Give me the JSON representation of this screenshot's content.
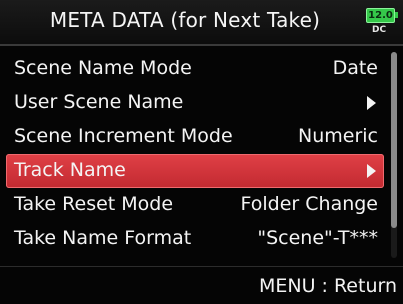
{
  "header": {
    "title": "META DATA (for Next Take)",
    "battery_level": "12.0",
    "power_source": "DC"
  },
  "menu": {
    "items": [
      {
        "label": "Scene Name Mode",
        "value": "Date"
      },
      {
        "label": "User Scene Name",
        "value": "",
        "submenu": true
      },
      {
        "label": "Scene Increment Mode",
        "value": "Numeric"
      },
      {
        "label": "Track Name",
        "value": "",
        "submenu": true,
        "selected": true
      },
      {
        "label": "Take Reset Mode",
        "value": "Folder Change"
      },
      {
        "label": "Take Name Format",
        "value": "\"Scene\"-T***"
      }
    ]
  },
  "footer": {
    "hint": "MENU : Return"
  },
  "colors": {
    "selected_row": "#d4353b",
    "battery": "#35c84a"
  },
  "icons": {
    "submenu": "arrow-right-icon",
    "battery": "battery-icon"
  }
}
